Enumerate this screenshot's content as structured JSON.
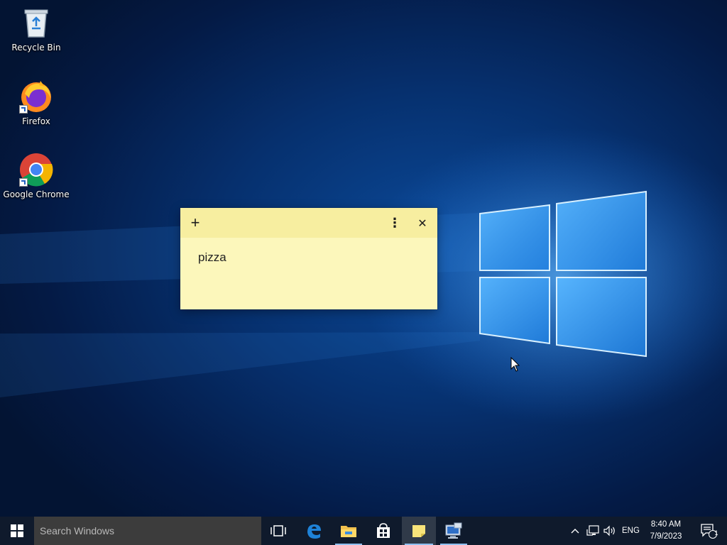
{
  "desktop": {
    "icons": [
      {
        "label": "Recycle Bin",
        "icon": "recycle-bin-icon"
      },
      {
        "label": "Firefox",
        "icon": "firefox-icon"
      },
      {
        "label": "Google Chrome",
        "icon": "chrome-icon"
      }
    ]
  },
  "sticky_note": {
    "text": "pizza",
    "new_note_glyph": "+",
    "menu_glyph": "⋮",
    "close_glyph": "✕",
    "background": "#fcf7bb"
  },
  "taskbar": {
    "search_placeholder": "Search Windows",
    "apps": [
      {
        "name": "task-view",
        "icon": "task-view-icon"
      },
      {
        "name": "edge",
        "icon": "edge-icon"
      },
      {
        "name": "file-explorer",
        "icon": "folder-icon"
      },
      {
        "name": "store",
        "icon": "store-icon"
      },
      {
        "name": "sticky-notes",
        "icon": "sticky-notes-icon",
        "active": true
      },
      {
        "name": "remote-desktop",
        "icon": "remote-desktop-icon"
      }
    ],
    "tray": {
      "language": "ENG",
      "time": "8:40 AM",
      "date": "7/9/2023",
      "notification_count": "1"
    }
  },
  "colors": {
    "taskbar": "#0f1a2c",
    "accent": "#8fbff0",
    "wallpaper": "#0b4a9a"
  }
}
